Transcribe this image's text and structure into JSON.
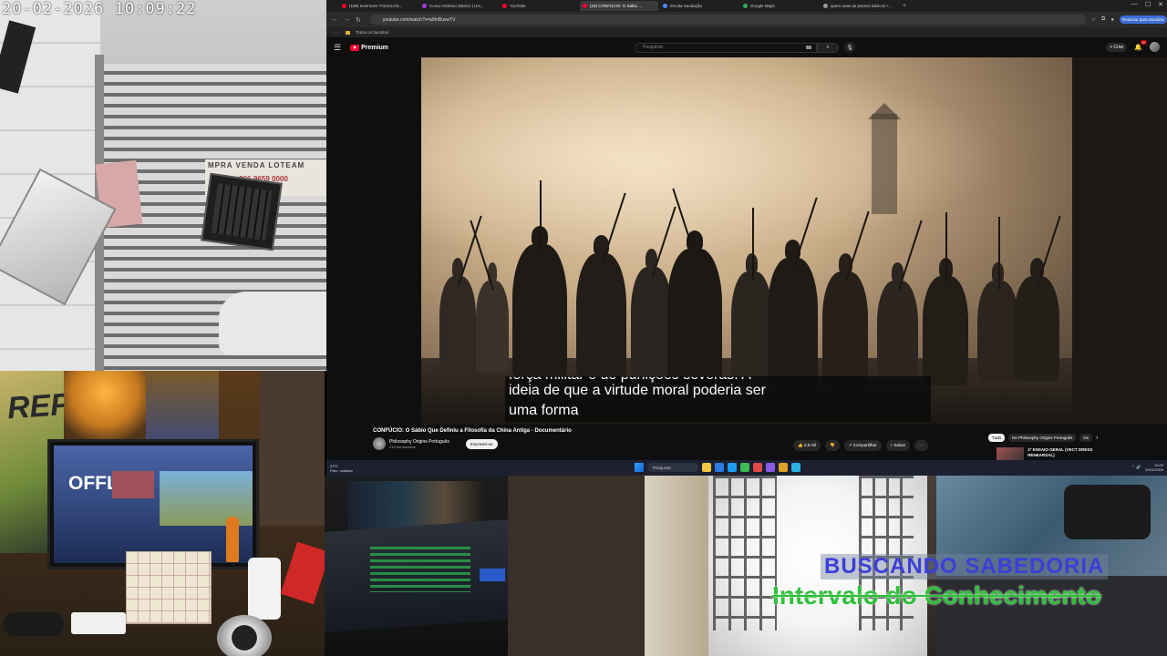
{
  "camera": {
    "timestamp": "20-02-2026 10:09:22",
    "sign_text": "MPRA  VENDA  LOTEAM",
    "sign_phone": "966-9659 0000"
  },
  "desk": {
    "art_text": "REP",
    "monitor_text": "OFFL"
  },
  "overlay": {
    "title": "BUSCANDO  SABEDORIA",
    "subtitle": "Intervalo do Conhecimento",
    "title_color": "#3b3fd8",
    "subtitle_color": "#2fbf3a"
  },
  "browser": {
    "tabs": [
      {
        "label": "(188) Inversoes YOUGLOS...",
        "color": "#ff0033",
        "active": false
      },
      {
        "label": "Curso Histórico Básico | Um...",
        "color": "#a040e0",
        "active": false
      },
      {
        "label": "YouTube",
        "color": "#ff0033",
        "active": false
      },
      {
        "label": "(23) CONFÚCIO: O Sábio ...",
        "color": "#ff0033",
        "active": true
      },
      {
        "label": "Escola Saudação",
        "color": "#4a8af4",
        "active": false
      },
      {
        "label": "Google Maps",
        "color": "#34a853",
        "active": false
      },
      {
        "label": "quero suas as passos básicos +...",
        "color": "#999999",
        "active": false
      }
    ],
    "new_tab": "+",
    "window_controls": [
      "—",
      "☐",
      "✕"
    ],
    "url": "youtube.com/watch?v=a9tnBuvwTV",
    "restart_label": "Reiniciar para atualizar",
    "bookmark_label": "Todos os favoritos"
  },
  "youtube": {
    "logo_text": "Premium",
    "search_placeholder": "Pesquisar",
    "create_label": "+ Criar",
    "bell_badge": "9+",
    "video_title": "CONFÚCIO: O Sábio Que Definiu a Filosofia da China Antiga - Documentário",
    "channel_name": "Philosophy Origins Português",
    "channel_subs": "213 mil inscritos",
    "subscribe_label": "Inscrever-se",
    "actions": [
      "👍 2,8 mil",
      "👎",
      "↗ Compartilhar",
      "+ Salvar",
      "⋯"
    ],
    "chips": [
      "Tudo",
      "De Philosophy Origins Português",
      "De"
    ],
    "chip_arrow": "›",
    "rec_title": "2º ENSAIO GERAL (VECT DRESS REHEARSAL)",
    "subtitles": {
      "cut_line": "força militar e de punições severas. A",
      "line1": "ideia de que a virtude moral poderia ser",
      "line2": "uma forma"
    }
  },
  "taskbar": {
    "weather_temp": "23°C",
    "weather_desc": "Parc. nublado",
    "search_placeholder": "Pesquisar",
    "app_colors": [
      "#f2c744",
      "#2a7ae2",
      "#1d9bf0",
      "#3fb950",
      "#e24a4a",
      "#8a5ae2",
      "#e2a02a",
      "#2ab0e2"
    ],
    "clock_time": "10:09",
    "clock_date": "20/02/2026",
    "tray": "⌃  🔊"
  }
}
